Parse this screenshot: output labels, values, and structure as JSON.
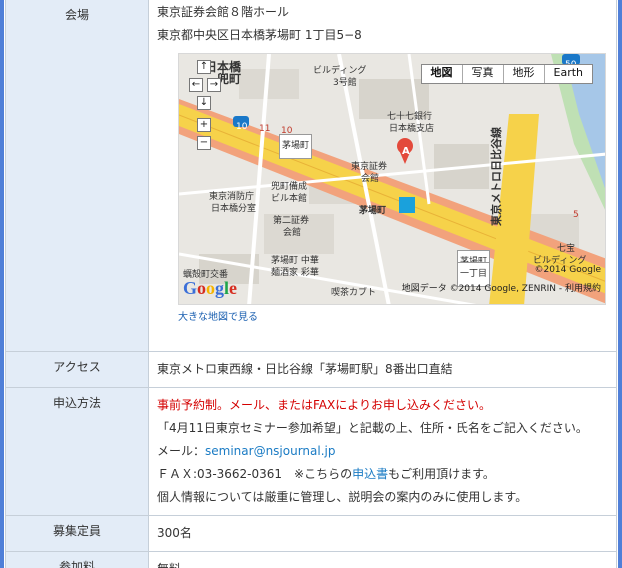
{
  "venue": {
    "label": "会場",
    "line1": "東京証券会館８階ホール",
    "line2": "東京都中央区日本橋茅場町 1丁目5−8",
    "map": {
      "buttons": [
        "地図",
        "写真",
        "地形",
        "Earth"
      ],
      "active_button": "地図",
      "controls": {
        "up": "↑",
        "left": "←",
        "right": "→",
        "down": "↓",
        "zoom_in": "+",
        "zoom_out": "−"
      },
      "labels": {
        "nihonbashi": "日本橋",
        "kabutocho": "兜町",
        "building3": "ビルディング",
        "building3b": "3号館",
        "bank": "七十七銀行",
        "bank2": "日本橋支店",
        "kayabacho_sign": "茅場町",
        "venue_a": "東京証券",
        "venue_b": "会館",
        "fire1": "東京消防庁",
        "fire2": "日本橋分室",
        "bigbldg1": "兜町備成",
        "bigbldg2": "ビル本館",
        "no2_1": "第二証券",
        "no2_2": "会館",
        "station": "茅場町",
        "chuka1": "茅場町 中華",
        "chuka2": "麺酒家 彩華",
        "kafuto": "喫茶カブト",
        "kokaten": "蠣殻町交番",
        "kayabacho_1": "茅場町",
        "kayabacho_2": "一丁目",
        "tozai_line": "東京メトロ日比谷線",
        "building_r": "ビルディング",
        "nana": "七宝",
        "kuni": "Google",
        "num10a": "10",
        "num10b": "10",
        "num11": "11",
        "num50": "50",
        "num5": "5",
        "pin": "A"
      },
      "copyright": "©2014 Google",
      "footer": "地図データ ©2014 Google, ZENRIN - 利用規約",
      "logo": "Google"
    },
    "map_link": "大きな地図で見る"
  },
  "access": {
    "label": "アクセス",
    "text": "東京メトロ東西線・日比谷線「茅場町駅」8番出口直結"
  },
  "apply": {
    "label": "申込方法",
    "line1": "事前予約制。メール、またはFAXによりお申し込みください。",
    "line2": "「4月11日東京セミナー参加希望」と記載の上、住所・氏名をご記入ください。",
    "mail_prefix": "メール：",
    "mail": "seminar@nsjournal.jp",
    "fax_prefix": "ＦＡＸ:03-3662-0361　※こちらの",
    "fax_link": "申込書",
    "fax_suffix": "もご利用頂けます。",
    "line5": "個人情報については厳重に管理し、説明会の案内のみに使用します。"
  },
  "capacity": {
    "label": "募集定員",
    "value": "300名"
  },
  "fee": {
    "label": "参加料",
    "value": "無料"
  },
  "colors": {
    "frame": "#4f7fd8",
    "label_bg": "#e3ecf7",
    "notice_red": "#d40000",
    "link_blue": "#1a7bc4",
    "road_yellow": "#f6d24a",
    "road_pink": "#f2a27c"
  }
}
